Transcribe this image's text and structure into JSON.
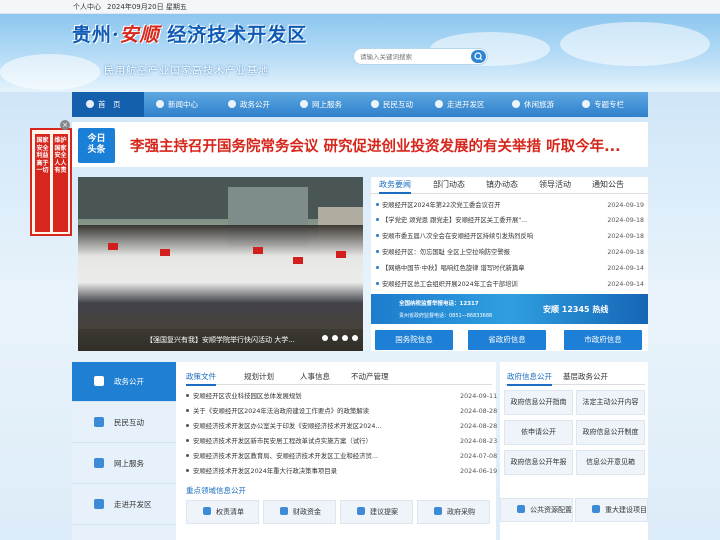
{
  "topbar": {
    "user_center": "个人中心",
    "date": "2024年09月20日 星期五"
  },
  "header": {
    "title_a": "贵州·",
    "title_b": "安顺",
    "title_c": " 经济技术开发区",
    "subtitle": "民用航空产业国家高技术产业基地"
  },
  "search": {
    "placeholder": "请输入关键词搜索",
    "button_icon": "search-icon"
  },
  "nav": {
    "items": [
      {
        "label": "首　页",
        "icon": "home-icon"
      },
      {
        "label": "新闻中心",
        "icon": "news-icon"
      },
      {
        "label": "政务公开",
        "icon": "document-icon"
      },
      {
        "label": "网上服务",
        "icon": "service-icon"
      },
      {
        "label": "民民互动",
        "icon": "chat-icon"
      },
      {
        "label": "走进开发区",
        "icon": "location-icon"
      },
      {
        "label": "休闲旅游",
        "icon": "travel-icon"
      },
      {
        "label": "专题专栏",
        "icon": "topic-icon"
      }
    ]
  },
  "float_ad": {
    "col1": "国家安全利益高于一切",
    "col2": "维护国家安全人人有责"
  },
  "headline": {
    "badge_line1": "今日",
    "badge_line2": "头条",
    "text": "李强主持召开国务院常务会议 研究促进创业投资发展的有关举措 听取今年..."
  },
  "photo": {
    "caption": "【强国复兴有我】安顺学院举行快闪活动 大学..."
  },
  "news": {
    "tabs": [
      "政务要闻",
      "部门动态",
      "镇办动态",
      "领导活动",
      "通知公告"
    ],
    "items": [
      {
        "title": "安顺经开区2024年第22次党工委会议召开",
        "date": "2024-09-19"
      },
      {
        "title": "【学党史 颂党恩 跟党走】安顺经开区关工委开展\"...",
        "date": "2024-09-18"
      },
      {
        "title": "安顺市委五届八次全会在安顺经开区持续引发热烈反响",
        "date": "2024-09-18"
      },
      {
        "title": "安顺经开区：勿忘国耻 全区上空拉响防空警报",
        "date": "2024-09-18"
      },
      {
        "title": "【网络中国节·中秋】唱响红色旋律 谱写时代新篇章",
        "date": "2024-09-14"
      },
      {
        "title": "安顺经开区总工会组织开展2024年工会干部培训",
        "date": "2024-09-14"
      }
    ]
  },
  "banner": {
    "line1": "全国纳税监督举报电话：12317",
    "line2": "贵州省政府监督电话：0851—86833688",
    "right": "安顺 12345 热线"
  },
  "quick_links": [
    "国务院信息",
    "省政府信息",
    "市政府信息"
  ],
  "left_menu": {
    "items": [
      {
        "label": "政务公开",
        "icon": "document-icon"
      },
      {
        "label": "民民互动",
        "icon": "chat-icon"
      },
      {
        "label": "网上服务",
        "icon": "service-icon"
      },
      {
        "label": "走进开发区",
        "icon": "location-icon"
      }
    ]
  },
  "policy": {
    "tabs": [
      "政策文件",
      "规划计划",
      "人事信息",
      "不动产管理"
    ],
    "items": [
      {
        "title": "安顺经开区农业科技园区总体发展规划",
        "date": "2024-09-11"
      },
      {
        "title": "关于《安顺经开区2024年法治政府建设工作要点》的政策解读",
        "date": "2024-08-28"
      },
      {
        "title": "安顺经济技术开发区办公室关于印发《安顺经济技术开发区2024...",
        "date": "2024-08-28"
      },
      {
        "title": "安顺经济技术开发区新市民安居工程改革试点实施方案（试行）",
        "date": "2024-08-23"
      },
      {
        "title": "安顺经济技术开发区教育局、安顺经济技术开发区工业和经济贸...",
        "date": "2024-07-08"
      },
      {
        "title": "安顺经济技术开发区2024年重大行政决策事项目录",
        "date": "2024-06-19"
      }
    ],
    "focus_title": "重点领域信息公开",
    "focus_buttons": [
      {
        "label": "权责清单",
        "icon": "list-icon"
      },
      {
        "label": "财政资金",
        "icon": "money-icon"
      },
      {
        "label": "建议提案",
        "icon": "proposal-icon"
      },
      {
        "label": "政府采购",
        "icon": "purchase-icon"
      },
      {
        "label": "公共资源配置",
        "icon": "resource-icon"
      },
      {
        "label": "重大建设项目",
        "icon": "project-icon"
      }
    ]
  },
  "gov_info": {
    "tabs": [
      "政府信息公开",
      "基层政务公开"
    ],
    "buttons": [
      "政府信息公开指南",
      "法定主动公开内容",
      "依申请公开",
      "政府信息公开制度",
      "政府信息公开年报",
      "信息公开意见箱"
    ]
  }
}
